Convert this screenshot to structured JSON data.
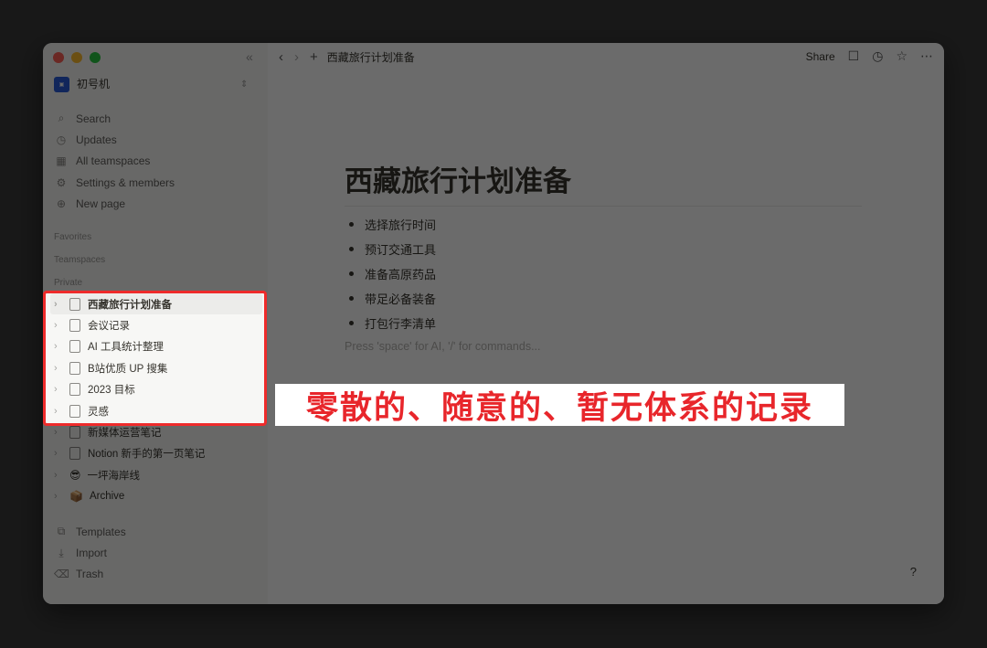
{
  "window": {
    "traffic_colors": [
      "#ff5f57",
      "#febc2e",
      "#28c840"
    ]
  },
  "sidebar": {
    "workspace": {
      "logo_text": "初号机",
      "name": "初号机"
    },
    "nav": [
      {
        "icon": "search-icon",
        "glyph": "⌕",
        "label": "Search"
      },
      {
        "icon": "clock-icon",
        "glyph": "◷",
        "label": "Updates"
      },
      {
        "icon": "grid-icon",
        "glyph": "▦",
        "label": "All teamspaces"
      },
      {
        "icon": "gear-icon",
        "glyph": "⚙",
        "label": "Settings & members"
      },
      {
        "icon": "plus-circle-icon",
        "glyph": "⊕",
        "label": "New page"
      }
    ],
    "sections": {
      "favorites": "Favorites",
      "teamspaces": "Teamspaces",
      "private": "Private"
    },
    "pages": [
      {
        "label": "西藏旅行计划准备",
        "type": "doc",
        "active": true
      },
      {
        "label": "会议记录",
        "type": "doc"
      },
      {
        "label": "AI 工具统计整理",
        "type": "doc"
      },
      {
        "label": "B站优质 UP 搜集",
        "type": "doc"
      },
      {
        "label": "2023 目标",
        "type": "doc"
      },
      {
        "label": "灵感",
        "type": "doc"
      },
      {
        "label": "新媒体运营笔记",
        "type": "doc"
      },
      {
        "label": "Notion 新手的第一页笔记",
        "type": "doc"
      },
      {
        "label": "一坪海岸线",
        "type": "emoji",
        "emoji": "😎"
      },
      {
        "label": "Archive",
        "type": "emoji",
        "emoji": "📦"
      }
    ],
    "bottom": [
      {
        "icon": "templates-icon",
        "glyph": "⧉",
        "label": "Templates"
      },
      {
        "icon": "import-icon",
        "glyph": "⤓",
        "label": "Import"
      },
      {
        "icon": "trash-icon",
        "glyph": "🗑",
        "label": "Trash"
      }
    ]
  },
  "topbar": {
    "title": "西藏旅行计划准备",
    "share": "Share"
  },
  "page": {
    "title": "西藏旅行计划准备",
    "bullets": [
      "选择旅行时间",
      "预订交通工具",
      "准备高原药品",
      "带足必备装备",
      "打包行李清单"
    ],
    "placeholder": "Press 'space' for AI, '/' for commands...",
    "help": "?"
  },
  "annotation": {
    "callout": "零散的、随意的、暂无体系的记录",
    "color": "#e8262b"
  }
}
